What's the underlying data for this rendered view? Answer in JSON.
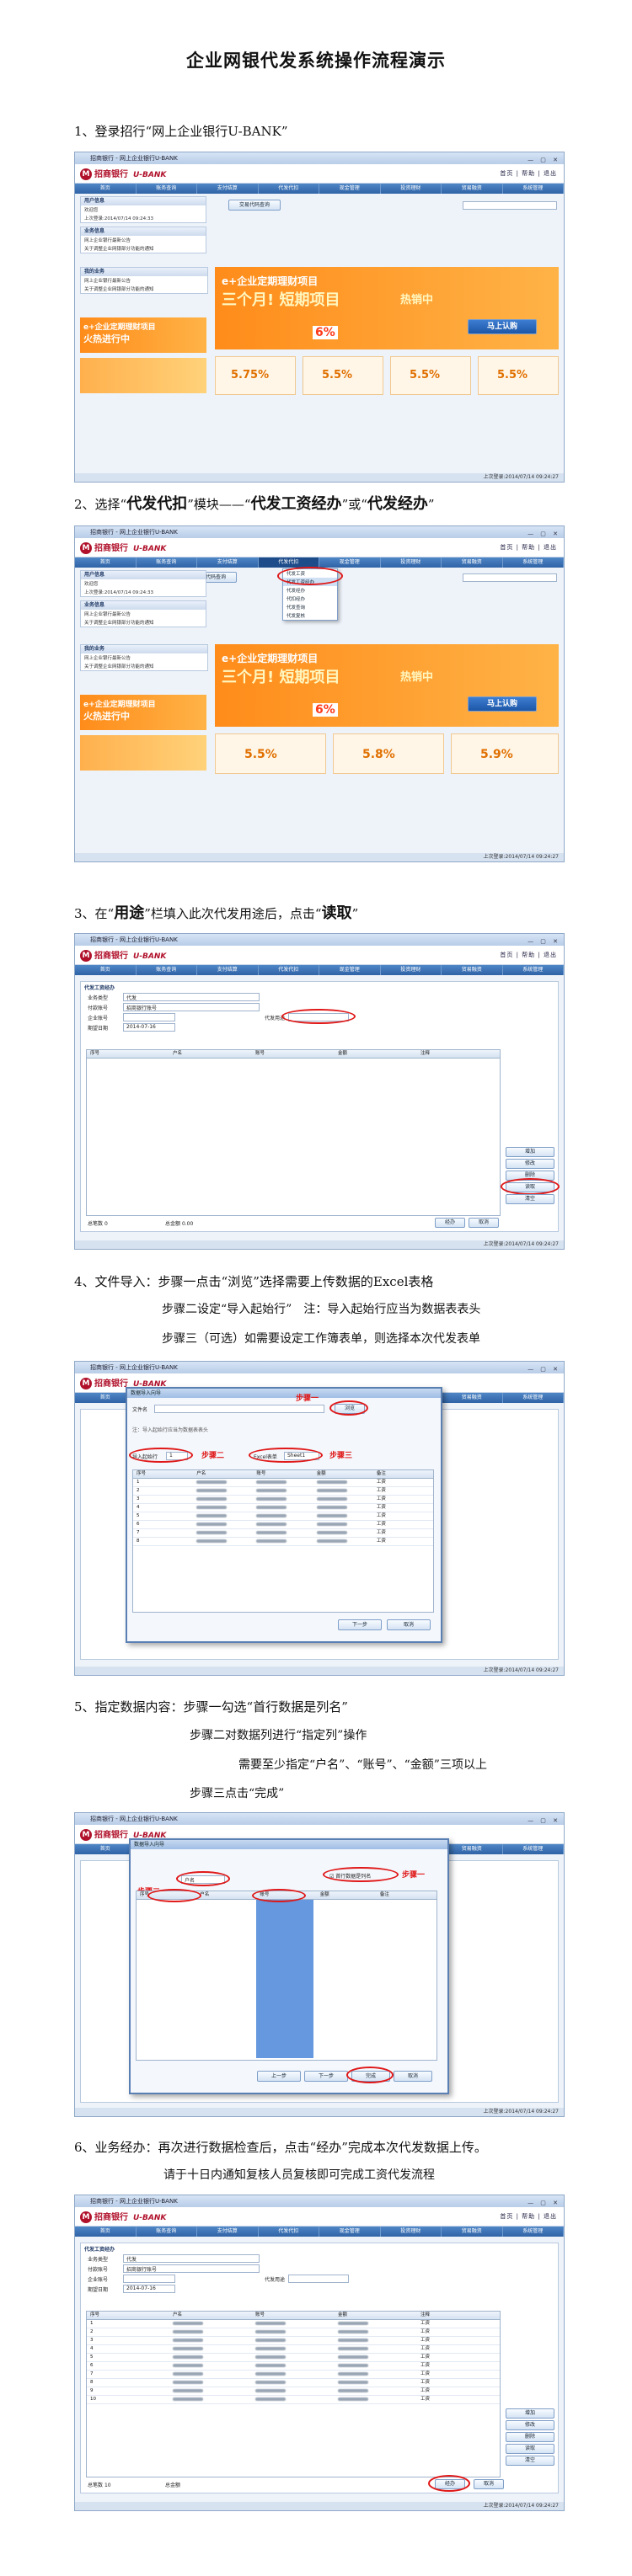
{
  "title": "企业网银代发系统操作流程演示",
  "steps": {
    "s1": "1、登录招行“网上企业银行U-BANK”",
    "s2a": "2、选择“",
    "s2b": "代发代扣",
    "s2c": "”模块——“",
    "s2d": "代发工资经办",
    "s2e": "”或“",
    "s2f": "代发经办",
    "s2g": "”",
    "s3a": "3、在“",
    "s3b": "用途",
    "s3c": "”栏填入此次代发用途后，点击“",
    "s3d": "读取",
    "s3e": "”",
    "s4a": "4、文件导入：步骤一点击“浏览”选择需要上传数据的Excel表格",
    "s4b": "步骤二设定“导入起始行”　注：导入起始行应当为数据表表头",
    "s4c": "步骤三（可选）如需要设定工作簿表单，则选择本次代发表单",
    "s5a": "5、指定数据内容：步骤一勾选“首行数据是列名”",
    "s5b": "步骤二对数据列进行“指定列”操作",
    "s5c": "需要至少指定“户名”、“账号”、“金额”三项以上",
    "s5d": "步骤三点击“完成”",
    "s6a": "6、业务经办：再次进行数据检查后，点击“经办”完成本次代发数据上传。",
    "s6b": "请于十日内通知复核人员复核即可完成工资代发流程"
  },
  "app": {
    "window_title": "招商银行 - 网上企业银行U-BANK",
    "bank_name": "招商银行",
    "ubank": "U-BANK",
    "logo_letter": "M",
    "top_links": "首页 | 帮助 | 退出",
    "menu": [
      "首页",
      "账务查询",
      "支付结算",
      "代发代扣",
      "现金管理",
      "投资理财",
      "贸易融资",
      "系统管理"
    ],
    "status": "上次登录:2014/07/14 09:24:27",
    "user_box": "用户信息",
    "user_lines": [
      "欢迎您",
      "上次登录:2014/07/14 09:24:33"
    ],
    "notice_box": "业务信息",
    "notice_lines": [
      "网上企业银行最新公告",
      "关于调整企业网银部分功能的通知"
    ],
    "service_box": "我的业务",
    "promo_main": "e+企业定期理财项目",
    "promo_sub": "三个月! 短期项目",
    "promo_hot": "热销中",
    "promo_btn": "马上认购",
    "promo_small": "火热进行中",
    "promo_rate": "6%",
    "rates": [
      "5.75%",
      "5.5%",
      "5.5%",
      "5.5%"
    ],
    "rates2": [
      "5.5%",
      "5.8%",
      "5.9%"
    ],
    "dropdown_items": [
      "代发工资",
      "代发工资经办",
      "代发经办",
      "代扣经办",
      "代发查询",
      "代发复核"
    ],
    "search_btn": "交易代码查询",
    "form_header": "代发工资经办",
    "form_labels": [
      "业务类型",
      "付款账号",
      "代发用途",
      "企业账号",
      "期望日期"
    ],
    "form_values": [
      "代发",
      "招商银行账号",
      "",
      "",
      "2014-07-16"
    ],
    "grid_headers": [
      "序号",
      "户名",
      "账号",
      "金额",
      "注释"
    ],
    "side_buttons": [
      "增加",
      "修改",
      "删除",
      "读取",
      "清空"
    ],
    "bottom_buttons": [
      "经办",
      "取消"
    ],
    "total_label": "总笔数",
    "total_amount": "总金额",
    "total_count": "0",
    "total_sum": "0.00",
    "total_count6": "10",
    "dialog_title": "数据导入向导",
    "dialog_file_label": "文件名",
    "dialog_browse": "浏览",
    "dialog_start_label": "导入起始行",
    "dialog_start_val": "1",
    "dialog_sheet_label": "Excel表单",
    "dialog_sheet_val": "Sheet1",
    "dialog_note": "注：导入起始行应当为数据表表头",
    "callout1": "步骤一",
    "callout2": "步骤二",
    "callout3": "步骤三",
    "dialog_cols": [
      "序号",
      "户名",
      "账号",
      "金额",
      "备注"
    ],
    "dialog_check": "首行数据是列名",
    "dialog_next": "下一步",
    "dialog_finish": "完成",
    "dialog_prev": "上一步",
    "dialog_cancel": "取消",
    "remark": "工资"
  }
}
